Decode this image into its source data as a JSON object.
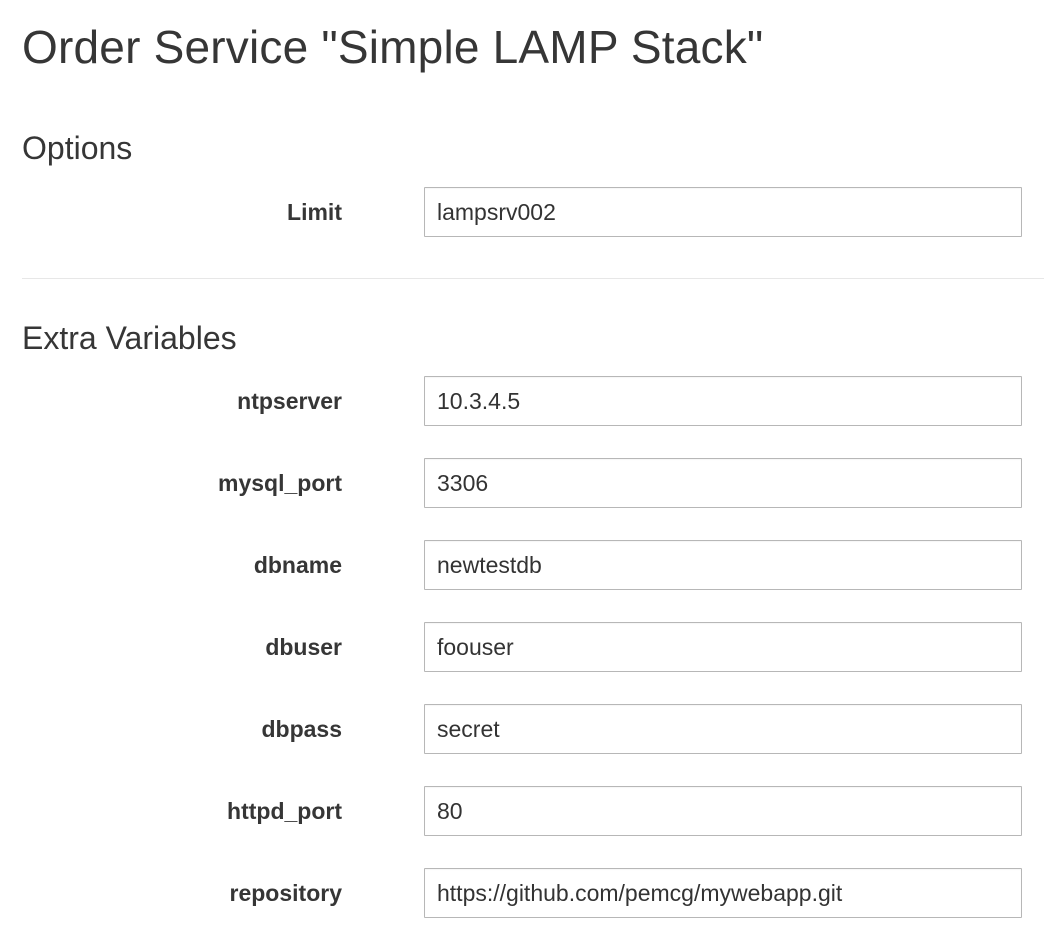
{
  "page": {
    "title": "Order Service \"Simple LAMP Stack\""
  },
  "options": {
    "title": "Options",
    "fields": [
      {
        "label": "Limit",
        "value": "lampsrv002"
      }
    ]
  },
  "extra_variables": {
    "title": "Extra Variables",
    "fields": [
      {
        "label": "ntpserver",
        "value": "10.3.4.5"
      },
      {
        "label": "mysql_port",
        "value": "3306"
      },
      {
        "label": "dbname",
        "value": "newtestdb"
      },
      {
        "label": "dbuser",
        "value": "foouser"
      },
      {
        "label": "dbpass",
        "value": "secret"
      },
      {
        "label": "httpd_port",
        "value": "80"
      },
      {
        "label": "repository",
        "value": "https://github.com/pemcg/mywebapp.git"
      }
    ]
  }
}
